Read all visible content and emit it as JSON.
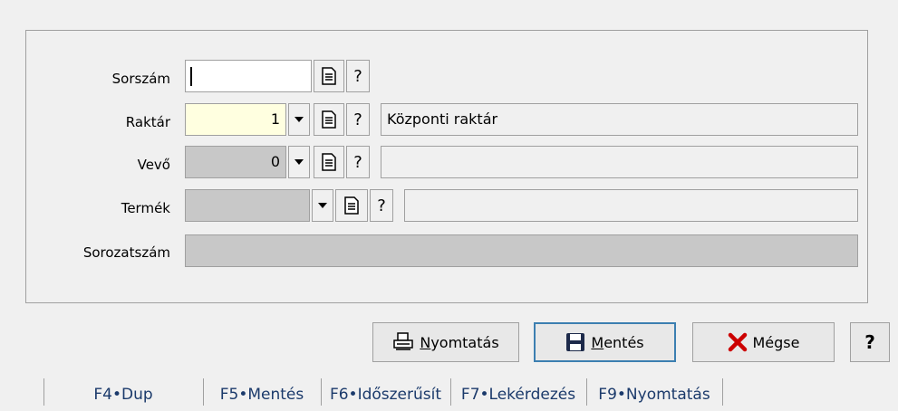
{
  "form": {
    "sorszam": {
      "label": "Sorszám",
      "value": ""
    },
    "raktar": {
      "label": "Raktár",
      "value": "1",
      "name": "Központi raktár"
    },
    "vevo": {
      "label": "Vevő",
      "value": "0",
      "name": ""
    },
    "termek": {
      "label": "Termék",
      "value": "",
      "name": ""
    },
    "sorozatszam": {
      "label": "Sorozatszám",
      "value": ""
    }
  },
  "help_glyph": "?",
  "buttons": {
    "print": {
      "prefix": "",
      "underlined": "N",
      "rest": "yomtatás"
    },
    "save": {
      "underlined": "M",
      "rest": "entés"
    },
    "cancel": {
      "label": "Mégse"
    },
    "help": {
      "label": "?"
    }
  },
  "function_keys": [
    "F4•Dup",
    "F5•Mentés",
    "F6•Időszerűsít",
    "F7•Lekérdezés",
    "F9•Nyomtatás"
  ],
  "colors": {
    "required_field": "#ffffe0",
    "disabled_field": "#c8c8c8",
    "fkey_text": "#1b3a6b",
    "cancel_icon": "#cc0000"
  },
  "icons": [
    "document-icon",
    "dropdown-arrow-icon",
    "help-icon",
    "printer-icon",
    "save-disk-icon",
    "cancel-x-icon"
  ]
}
